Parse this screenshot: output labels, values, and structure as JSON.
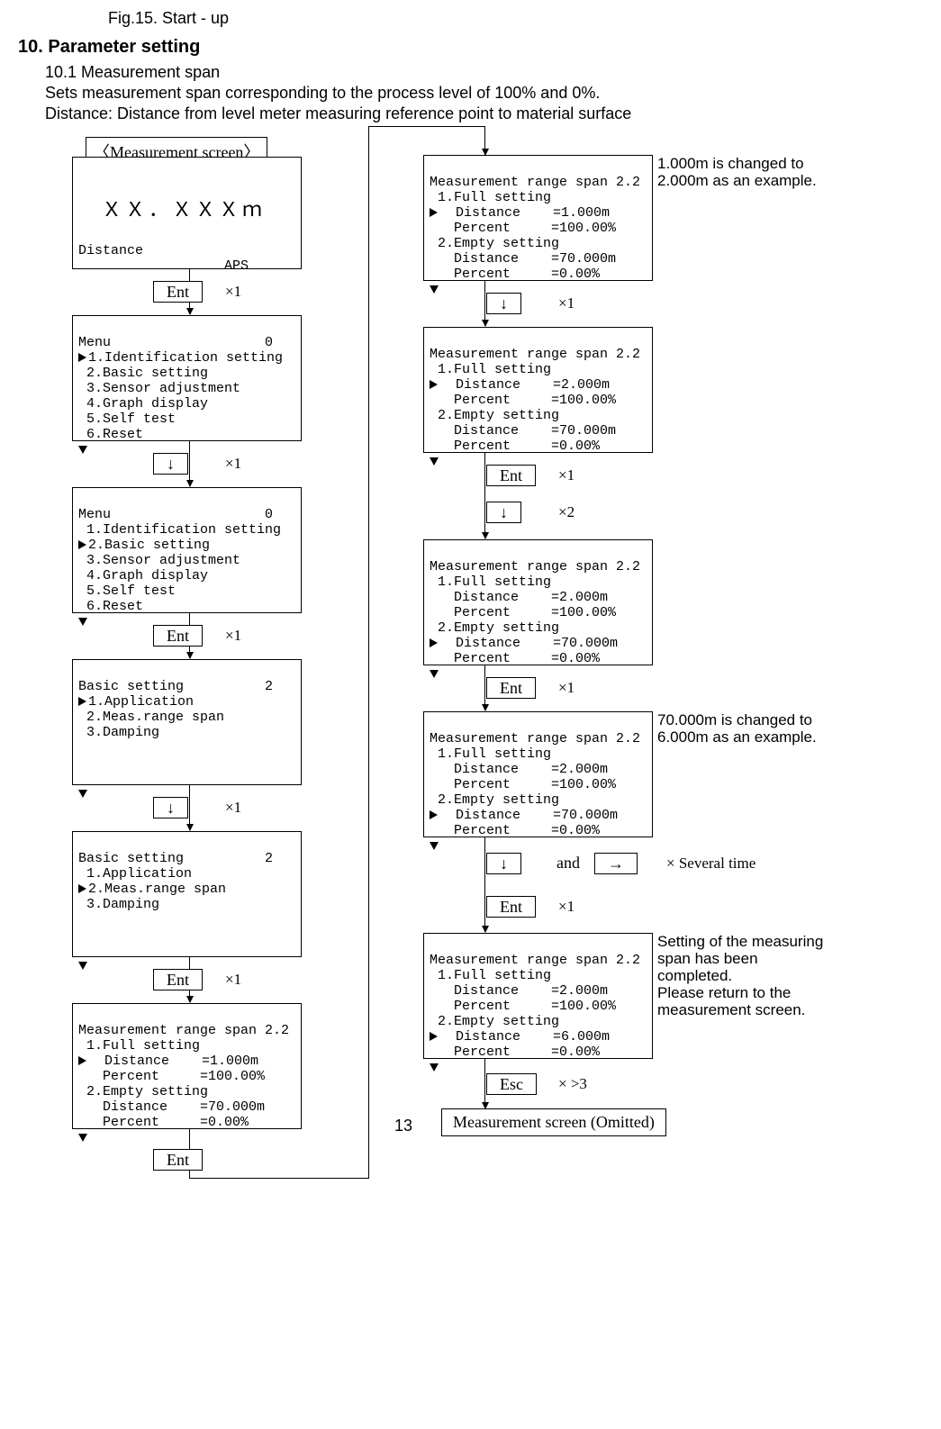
{
  "fig_caption": "Fig.15. Start - up",
  "h10": "10. Parameter setting",
  "sub101": "10.1 Measurement span",
  "body1": "Sets measurement span corresponding to the process level of 100% and 0%.",
  "body2": "Distance: Distance from level meter measuring reference point to material surface",
  "meas_screen_label": "〈Measurement screen〉",
  "meas_screen": {
    "row1": "　　　　　　　　　　",
    "kana": "　ＸＸ．ＸＸＸｍ",
    "distance": "Distance",
    "aps": "                  APS"
  },
  "btn_ent": "Ent",
  "btn_down": "↓",
  "btn_right": "→",
  "btn_esc": "Esc",
  "times1": "×1",
  "times2": "×2",
  "timesSeveral": "× Several time",
  "timesGt3": "× >3",
  "and": "and",
  "menu0": {
    "title": "Menu                   0",
    "l1": "1.Identification setting",
    "l2": "2.Basic setting",
    "l3": "3.Sensor adjustment",
    "l4": "4.Graph display",
    "l5": "5.Self test",
    "l6": "6.Reset"
  },
  "basic": {
    "title": "Basic setting          2",
    "l1": "1.Application",
    "l2": "2.Meas.range span",
    "l3": "3.Damping"
  },
  "span": {
    "title": "Measurement range span 2.2",
    "full": "1.Full setting",
    "empty": "2.Empty setting",
    "dist1": "  Distance    =1.000m",
    "dist1b": "  Distance    =1.000m",
    "dist2": "  Distance    =2.000m",
    "dist2e": "  Distance    =2.000m",
    "dist70": "  Distance    =70.000m",
    "dist70b": "  Distance    =70.000m",
    "dist6": "  Distance    =6.000m",
    "perc100": "  Percent     =100.00%",
    "perc0": "  Percent     =0.00%"
  },
  "annot1": "1.000m is changed to\n2.000m as an example.",
  "annot2": "70.000m is changed to\n6.000m as an example.",
  "annot3": "Setting of the measuring\nspan has been\ncompleted.\nPlease return to the\nmeasurement screen.",
  "omitted": "Measurement screen (Omitted)",
  "page_no": "13"
}
